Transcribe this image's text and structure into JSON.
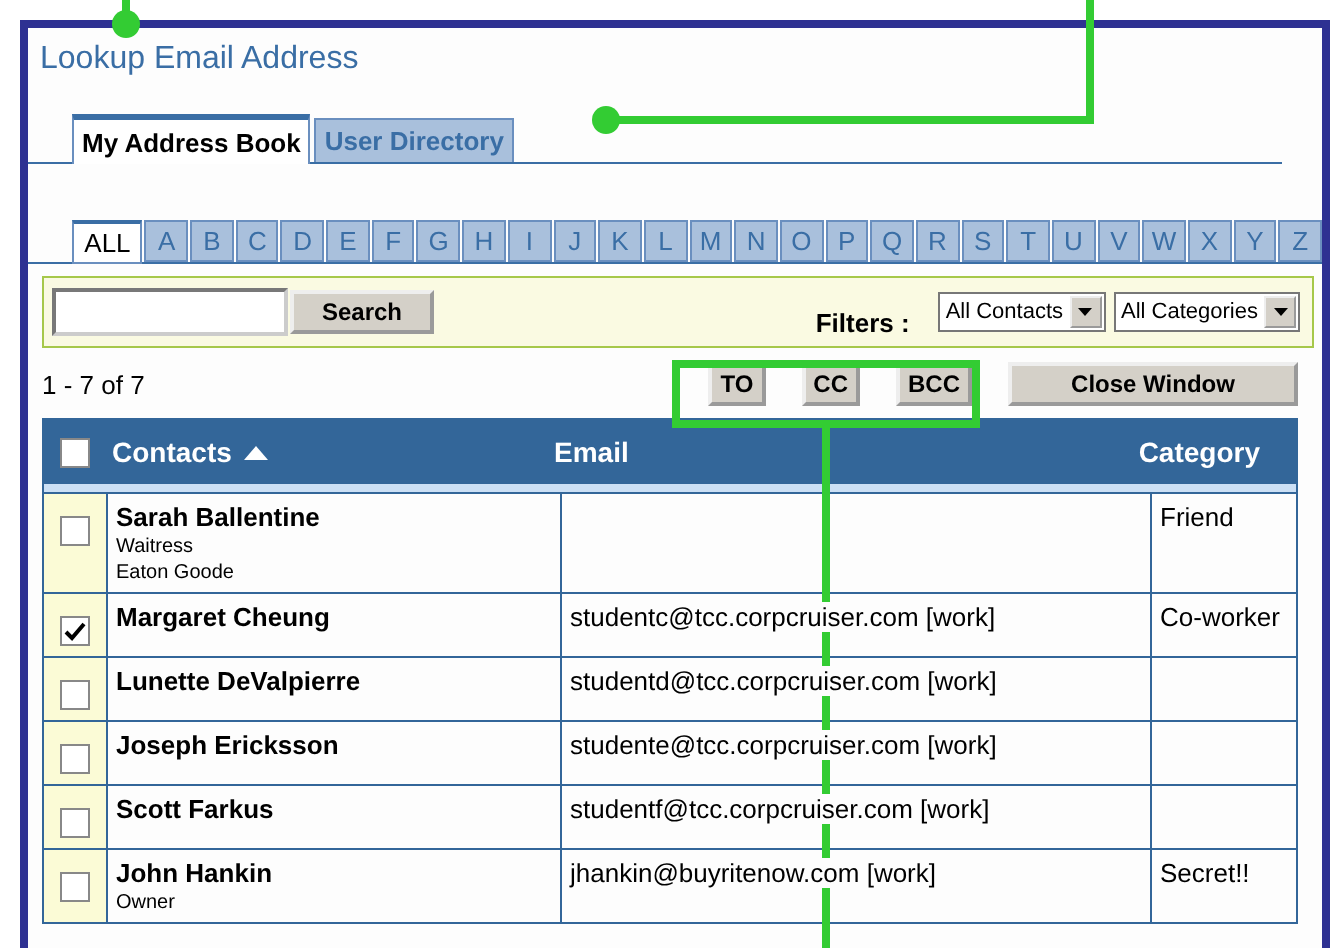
{
  "title": "Lookup Email Address",
  "tabs": [
    {
      "label": "My Address Book",
      "selected": true
    },
    {
      "label": "User Directory",
      "selected": false
    }
  ],
  "letters": [
    {
      "label": "ALL",
      "selected": true
    },
    {
      "label": "A",
      "selected": false
    },
    {
      "label": "B",
      "selected": false
    },
    {
      "label": "C",
      "selected": false
    },
    {
      "label": "D",
      "selected": false
    },
    {
      "label": "E",
      "selected": false
    },
    {
      "label": "F",
      "selected": false
    },
    {
      "label": "G",
      "selected": false
    },
    {
      "label": "H",
      "selected": false
    },
    {
      "label": "I",
      "selected": false
    },
    {
      "label": "J",
      "selected": false
    },
    {
      "label": "K",
      "selected": false
    },
    {
      "label": "L",
      "selected": false
    },
    {
      "label": "M",
      "selected": false
    },
    {
      "label": "N",
      "selected": false
    },
    {
      "label": "O",
      "selected": false
    },
    {
      "label": "P",
      "selected": false
    },
    {
      "label": "Q",
      "selected": false
    },
    {
      "label": "R",
      "selected": false
    },
    {
      "label": "S",
      "selected": false
    },
    {
      "label": "T",
      "selected": false
    },
    {
      "label": "U",
      "selected": false
    },
    {
      "label": "V",
      "selected": false
    },
    {
      "label": "W",
      "selected": false
    },
    {
      "label": "X",
      "selected": false
    },
    {
      "label": "Y",
      "selected": false
    },
    {
      "label": "Z",
      "selected": false
    }
  ],
  "search": {
    "button": "Search"
  },
  "filters": {
    "label": "Filters :",
    "contacts": "All Contacts",
    "categories": "All Categories"
  },
  "count": "1 - 7 of 7",
  "recipient_buttons": [
    "TO",
    "CC",
    "BCC"
  ],
  "close_button": "Close Window",
  "table": {
    "select_all_checked": false,
    "columns": [
      {
        "label": "Contacts",
        "sorted": true
      },
      {
        "label": "Email",
        "sorted": false
      },
      {
        "label": "Category",
        "sorted": false
      }
    ],
    "rows": [
      {
        "checked": false,
        "name": "Sarah Ballentine",
        "details": [
          "Waitress",
          "Eaton Goode"
        ],
        "email": "",
        "category": "Friend"
      },
      {
        "checked": true,
        "name": "Margaret Cheung",
        "details": [],
        "email": "studentc@tcc.corpcruiser.com [work]",
        "category": "Co-worker"
      },
      {
        "checked": false,
        "name": "Lunette DeValpierre",
        "details": [],
        "email": "studentd@tcc.corpcruiser.com [work]",
        "category": ""
      },
      {
        "checked": false,
        "name": "Joseph Ericksson",
        "details": [],
        "email": "studente@tcc.corpcruiser.com [work]",
        "category": ""
      },
      {
        "checked": false,
        "name": "Scott Farkus",
        "details": [],
        "email": "studentf@tcc.corpcruiser.com [work]",
        "category": ""
      },
      {
        "checked": false,
        "name": "John Hankin",
        "details": [
          "Owner"
        ],
        "email": "jhankin@buyritenow.com [work]",
        "category": "Secret!!"
      }
    ]
  }
}
